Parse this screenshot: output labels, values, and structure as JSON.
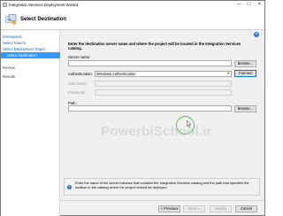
{
  "window": {
    "title": "Integration Services Deployment Wizard",
    "min_glyph": "—",
    "max_glyph": "☐",
    "close_glyph": "✕"
  },
  "header": {
    "title": "Select Destination",
    "icon": "deploy-wizard-icon"
  },
  "sidebar": {
    "items": [
      {
        "label": "Introduction",
        "state": "link"
      },
      {
        "label": "Select Source",
        "state": "link"
      },
      {
        "label": "Select Deployment Target",
        "state": "link"
      },
      {
        "label": "Select Destination",
        "state": "selected"
      },
      {
        "label": "Review",
        "state": "dim"
      },
      {
        "label": "Results",
        "state": "dim"
      }
    ]
  },
  "main": {
    "intro": "Enter the destination server name and where the project will be located in the Integration Services catalog.",
    "server_name_label": "Server name:",
    "server_name_value": "",
    "browse_label": "Browse...",
    "authentication_label": "Authentication:",
    "authentication_value": "Windows Authentication",
    "connect_label": "Connect",
    "user_name_label": "User name:",
    "password_label": "Password:",
    "path_label": "Path:",
    "path_value": "",
    "path_browse_label": "Browse...",
    "help_glyph": "?"
  },
  "info": {
    "glyph": "i",
    "text": "Enter the name of the server instance that contains the Integration Services catalog and the path that specifies the location in the catalog where the project should be deployed."
  },
  "watermark": "PowerbiSchool.ir",
  "footer": {
    "previous_label": "< Previous",
    "next_label": "Next >",
    "deploy_label": "Deploy",
    "cancel_label": "Cancel"
  },
  "colors": {
    "selected": "#3399ff",
    "link": "#1f5ca8",
    "cursor_ring": "#5fbf5a"
  }
}
